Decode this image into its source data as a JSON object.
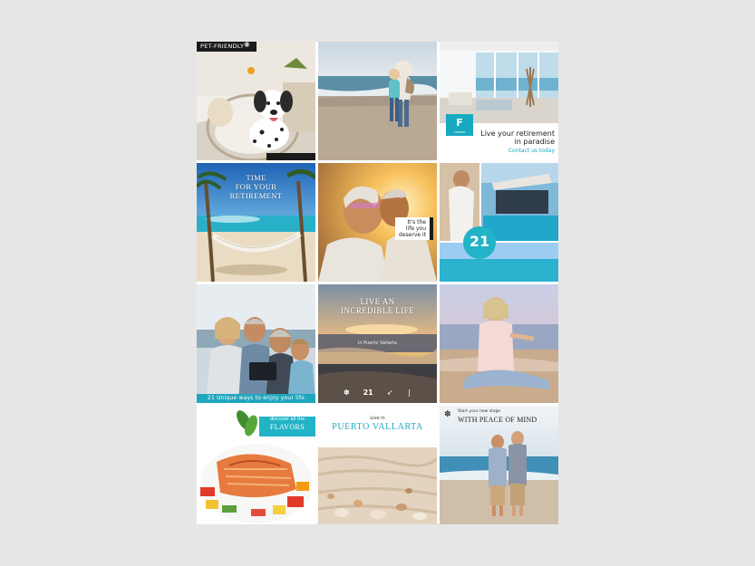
{
  "tiles": {
    "t1": {
      "badge": "PET-FRIENDLY"
    },
    "t3": {
      "logo_letter": "F",
      "logo_text": "FENDER",
      "line1": "Live your retirement",
      "line2": "in paradise",
      "line3": "Contact us today"
    },
    "t4": {
      "title_line1": "TIME",
      "title_line2": "FOR YOUR",
      "title_line3": "RETIREMENT"
    },
    "t5": {
      "line1": "It's the",
      "line2": "life you",
      "line3": "deserve it"
    },
    "t6": {
      "badge": "21"
    },
    "t7": {
      "bar_text": "21 Unique ways to enjoy your life"
    },
    "t8": {
      "title_line1": "LIVE AN",
      "title_line2": "INCREDIBLE LIFE",
      "subtitle": "in Puerto Vallarta",
      "logo_middle": "21"
    },
    "t10": {
      "ribbon_small": "discover all the",
      "ribbon_big": "FLAVORS"
    },
    "t11": {
      "small": "Live in",
      "title": "PUERTO VALLARTA"
    },
    "t12": {
      "small": "Start your new stage",
      "title": "WITH PEACE OF MIND"
    }
  },
  "colors": {
    "teal": "#22b3c6",
    "dark": "#1a1a1a",
    "background": "#e6e6e6"
  }
}
